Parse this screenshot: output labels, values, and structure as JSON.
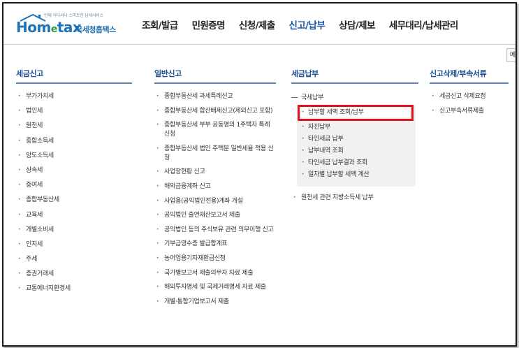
{
  "logo": {
    "tagline": "언제 어디서나 스마트한 납세서비스",
    "brand_home": "Hom",
    "brand_e": "e",
    "brand_tax": "tax",
    "brand_kr": "국세청홈택스"
  },
  "nav": {
    "items": [
      "조회/발급",
      "민원증명",
      "신청/제출",
      "신고/납부",
      "상담/제보",
      "세무대리/납세관리"
    ],
    "active_index": 3
  },
  "util_button": "메",
  "columns": {
    "tax_filing": {
      "title": "세금신고",
      "items": [
        "부가가치세",
        "법인세",
        "원천세",
        "종합소득세",
        "양도소득세",
        "상속세",
        "증여세",
        "종합부동산세",
        "교육세",
        "개별소비세",
        "인지세",
        "주세",
        "증권거래세",
        "교통에너지환경세"
      ]
    },
    "general_filing": {
      "title": "일반신고",
      "items": [
        "종합부동산세 과세특례신고",
        "종합부동산세 합산배제신고(제외신고 포함)",
        "종합부동산세 부부 공동명의 1주택자 특례 신청",
        "종합부동산세 법인 주택분 일반세율 적용 신청",
        "사업장현황 신고",
        "해외금융계좌 신고",
        "사업용(공익법인전용)계좌 개설",
        "공익법인 출연재산보고서 제출",
        "공익법인 등의 주식보유 관련 의무이행 신고",
        "기부금영수증 발급합계표",
        "농어업용기자재환급신청",
        "국가별보고서 제출의무자 자료 제출",
        "해외투자명세 및 국제거래명세 자료 제출",
        "개별·통합기업보고서 제출"
      ]
    },
    "tax_payment": {
      "title": "세금납부",
      "group_label": "국세납부",
      "sub_items": [
        "납부할 세액 조회/납부",
        "자진납부",
        "타인세금 납부",
        "납부내역 조회",
        "타인세금 납부결과 조회",
        "일자별 납부할 세액 계산"
      ],
      "highlight_index": 0,
      "extra_item": "원천세 관련 지방소득세 납부"
    },
    "delete_docs": {
      "title": "신고삭제/부속서류",
      "items": [
        "세금신고 삭제요청",
        "신고부속서류제출"
      ]
    }
  },
  "colors": {
    "active_nav": "#1a56a8",
    "column_title": "#1c4f93",
    "highlight_border": "#e0121b",
    "brand_blue": "#1d73b8",
    "brand_green": "#2d9a3f"
  }
}
